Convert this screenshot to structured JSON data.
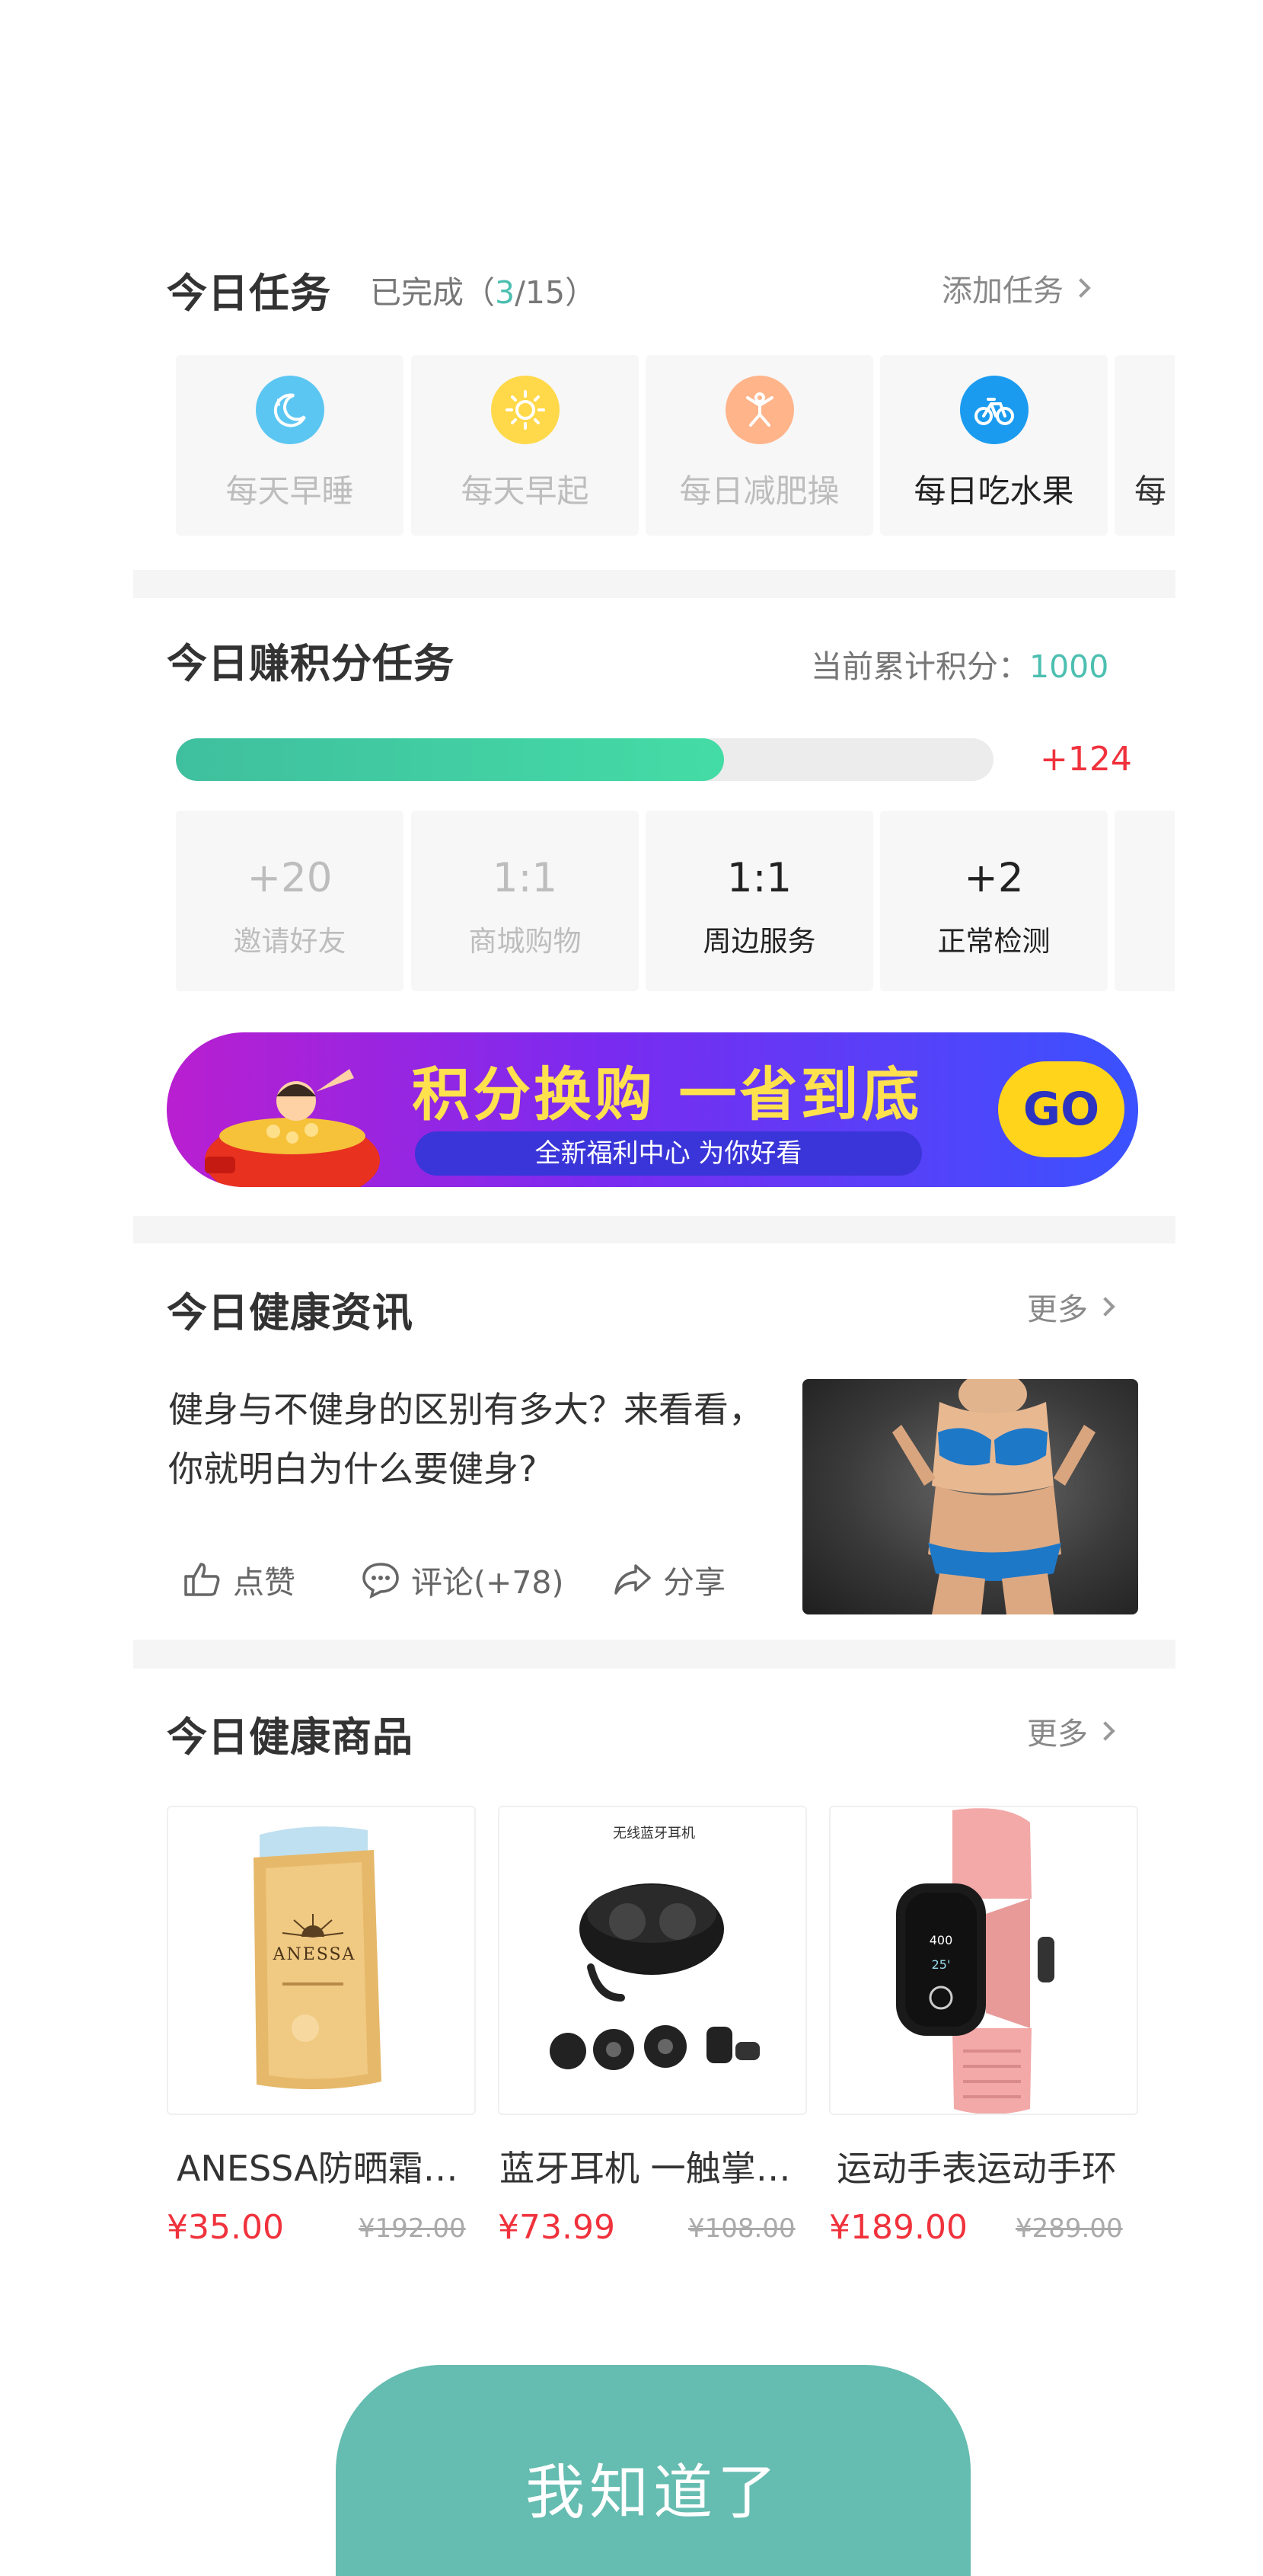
{
  "tasks_section": {
    "title": "今日任务",
    "completed_label": "已完成（",
    "completed_count": "3",
    "completed_total": "/15）",
    "add_label": "添加任务",
    "items": [
      {
        "label": "每天早睡",
        "icon": "moon-sleep-icon",
        "color": "#5cc6f2",
        "active": false
      },
      {
        "label": "每天早起",
        "icon": "sun-icon",
        "color": "#ffd94a",
        "active": false
      },
      {
        "label": "每日减肥操",
        "icon": "exercise-icon",
        "color": "#ffb48a",
        "active": false
      },
      {
        "label": "每日吃水果",
        "icon": "bicycle-icon",
        "color": "#1a9bf0",
        "active": true
      },
      {
        "label": "每",
        "icon": "",
        "color": "",
        "active": false
      }
    ]
  },
  "points_section": {
    "title": "今日赚积分任务",
    "total_label": "当前累计积分：",
    "total_value": "1000",
    "progress": 0.67,
    "progress_bonus": "+124",
    "items": [
      {
        "value": "+20",
        "label": "邀请好友",
        "active": false
      },
      {
        "value": "1:1",
        "label": "商城购物",
        "active": false
      },
      {
        "value": "1:1",
        "label": "周边服务",
        "active": true
      },
      {
        "value": "+2",
        "label": "正常检测",
        "active": true
      }
    ]
  },
  "banner": {
    "title": "积分换购 一省到底",
    "subtitle": "全新福利中心 为你好看",
    "go_label": "GO"
  },
  "news_section": {
    "title": "今日健康资讯",
    "more_label": "更多",
    "article_text": "健身与不健身的区别有多大？来看看，你就明白为什么要健身?",
    "like_label": "点赞",
    "comment_label": "评论(+78)",
    "share_label": "分享"
  },
  "products_section": {
    "title": "今日健康商品",
    "more_label": "更多",
    "items": [
      {
        "name": "ANESSA防晒霜防晒霜",
        "price": "¥35.00",
        "old_price": "¥192.00"
      },
      {
        "name": "蓝牙耳机 一触掌控音乐",
        "price": "¥73.99",
        "old_price": "¥108.00",
        "image_caption": "无线蓝牙耳机"
      },
      {
        "name": "运动手表运动手环",
        "price": "¥189.00",
        "old_price": "¥289.00"
      }
    ]
  },
  "ok_button": {
    "label": "我知道了"
  },
  "colors": {
    "accent": "#4cbfb0",
    "price": "#f0323c",
    "button": "#65bcb0"
  }
}
